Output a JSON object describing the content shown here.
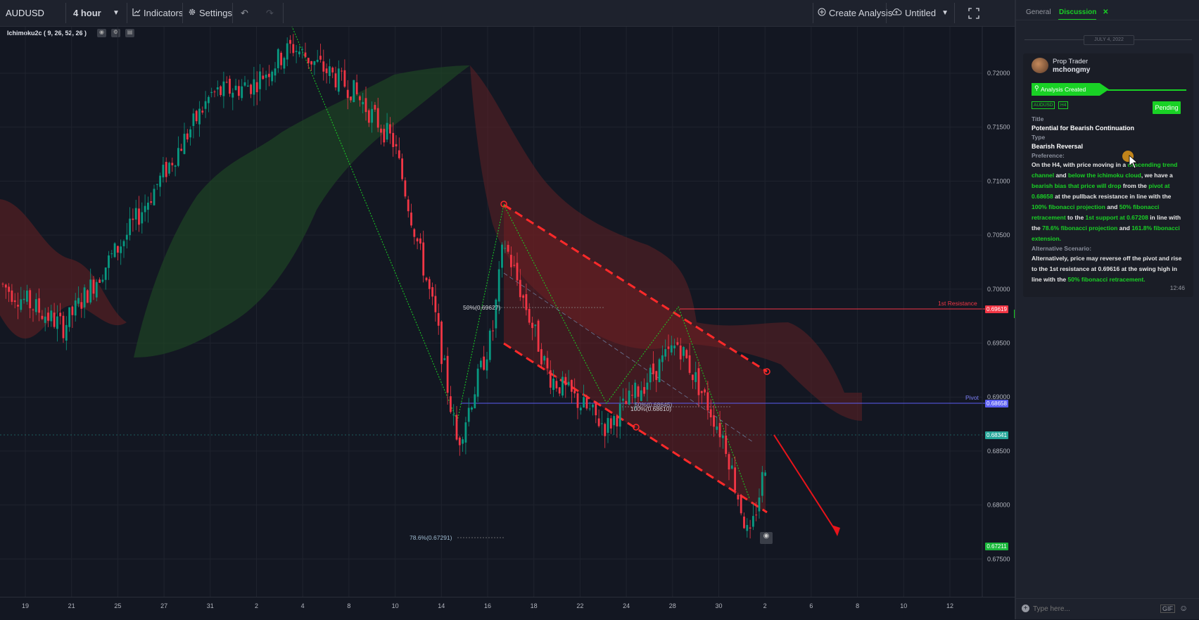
{
  "toolbar": {
    "symbol": "AUDUSD",
    "interval": "4 hour",
    "indicators_label": "Indicators",
    "settings_label": "Settings",
    "create_analysis_label": "Create Analysis",
    "layout_name": "Untitled"
  },
  "indicator": {
    "label": "Ichimoku2c ( 9, 26, 52, 26 )"
  },
  "chart_data": {
    "type": "candlestick",
    "symbol": "AUDUSD",
    "interval": "4 hour",
    "y_ticks": [
      "0.72000",
      "0.71500",
      "0.71000",
      "0.70500",
      "0.70000",
      "0.69500",
      "0.69000",
      "0.68500",
      "0.68000",
      "0.67500"
    ],
    "x_ticks": [
      "19",
      "21",
      "25",
      "27",
      "31",
      "2",
      "4",
      "8",
      "10",
      "14",
      "16",
      "18",
      "22",
      "24",
      "28",
      "30",
      "2",
      "6",
      "8",
      "10",
      "12"
    ],
    "ylim": [
      0.6715,
      0.7243
    ],
    "price_lines": [
      {
        "label": "1st Resistance",
        "value": 0.69619,
        "tag": "0.69619",
        "color": "#f23645"
      },
      {
        "label": "Pivot",
        "value": 0.68658,
        "tag": "0.68658",
        "color": "#5b5ef2"
      }
    ],
    "last_price": {
      "tag": "0.68341",
      "value": 0.68341,
      "color": "#26a69a"
    },
    "bottom_price": {
      "tag": "0.67211",
      "value": 0.67211,
      "color": "#19b83a"
    },
    "fib_labels": [
      {
        "text": "50%(0.69627)",
        "value": 0.69627
      },
      {
        "text": "50%(0.68645)",
        "value": 0.68645
      },
      {
        "text": "100%(0.68610)",
        "value": 0.6861
      },
      {
        "text": "78.6%(0.67291)",
        "value": 0.67291
      }
    ],
    "grid": true
  },
  "sidebar": {
    "tabs": [
      "General",
      "Discussion"
    ],
    "active_tab": "Discussion",
    "close_glyph": "✕",
    "date_chip": "JULY 4, 2022",
    "author_role": "Prop Trader",
    "author_name": "mchongmy",
    "status_banner": "Analysis Created",
    "tags": [
      "AUDUSD",
      "H4"
    ],
    "status": "Pending",
    "title_label": "Title",
    "title_value": "Potential for Bearish Continuation",
    "type_label": "Type",
    "type_value": "Bearish Reversal",
    "preference_label": "Preference:",
    "alt_label": "Alternative Scenario:",
    "time": "12:46",
    "input_placeholder": "Type here...",
    "gif_label": "GIF"
  },
  "colors": {
    "bg": "#131722",
    "panel": "#1e222d",
    "accent_green": "#19d125",
    "bear": "#f23645",
    "bull": "#089981"
  }
}
